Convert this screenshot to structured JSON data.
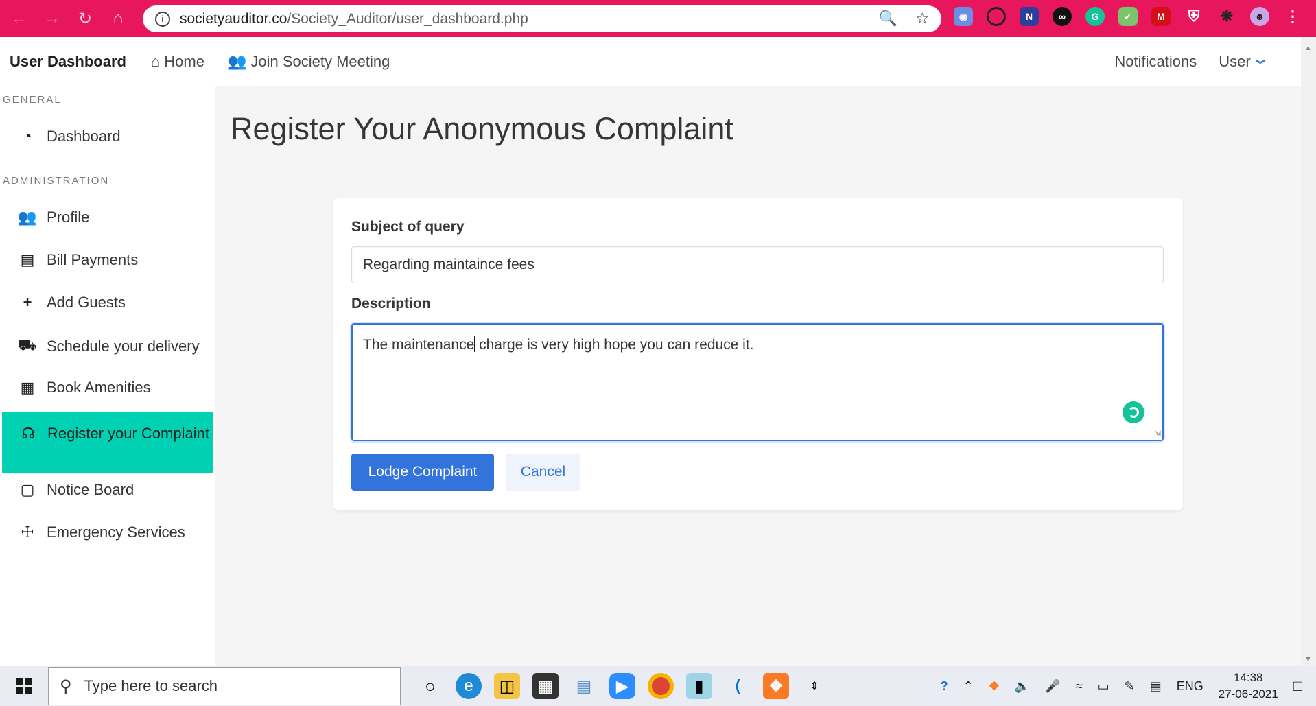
{
  "browser": {
    "url_domain": "societyauditor.co",
    "url_path": "/Society_Auditor/user_dashboard.php"
  },
  "navbar": {
    "brand": "User Dashboard",
    "home": "Home",
    "meeting": "Join Society Meeting",
    "notifications": "Notifications",
    "user": "User"
  },
  "sidebar": {
    "general_label": "GENERAL",
    "admin_label": "ADMINISTRATION",
    "items": [
      {
        "label": "Dashboard"
      },
      {
        "label": "Profile"
      },
      {
        "label": "Bill Payments"
      },
      {
        "label": "Add Guests"
      },
      {
        "label": "Schedule your delivery"
      },
      {
        "label": "Book Amenities"
      },
      {
        "label": "Register your Complaint"
      },
      {
        "label": "Notice Board"
      },
      {
        "label": "Emergency Services"
      }
    ]
  },
  "main": {
    "title": "Register Your Anonymous Complaint",
    "subject_label": "Subject of query",
    "subject_value": "Regarding maintaince fees",
    "description_label": "Description",
    "description_before_caret": "The maintenance",
    "description_after_caret": " charge is very high hope you can reduce it.",
    "submit": "Lodge Complaint",
    "cancel": "Cancel"
  },
  "taskbar": {
    "search_placeholder": "Type here to search",
    "language": "ENG",
    "time": "14:38",
    "date": "27-06-2021"
  },
  "colors": {
    "browser_accent": "#e8175d",
    "active_menu": "#00d1b2",
    "primary": "#3273dc"
  }
}
